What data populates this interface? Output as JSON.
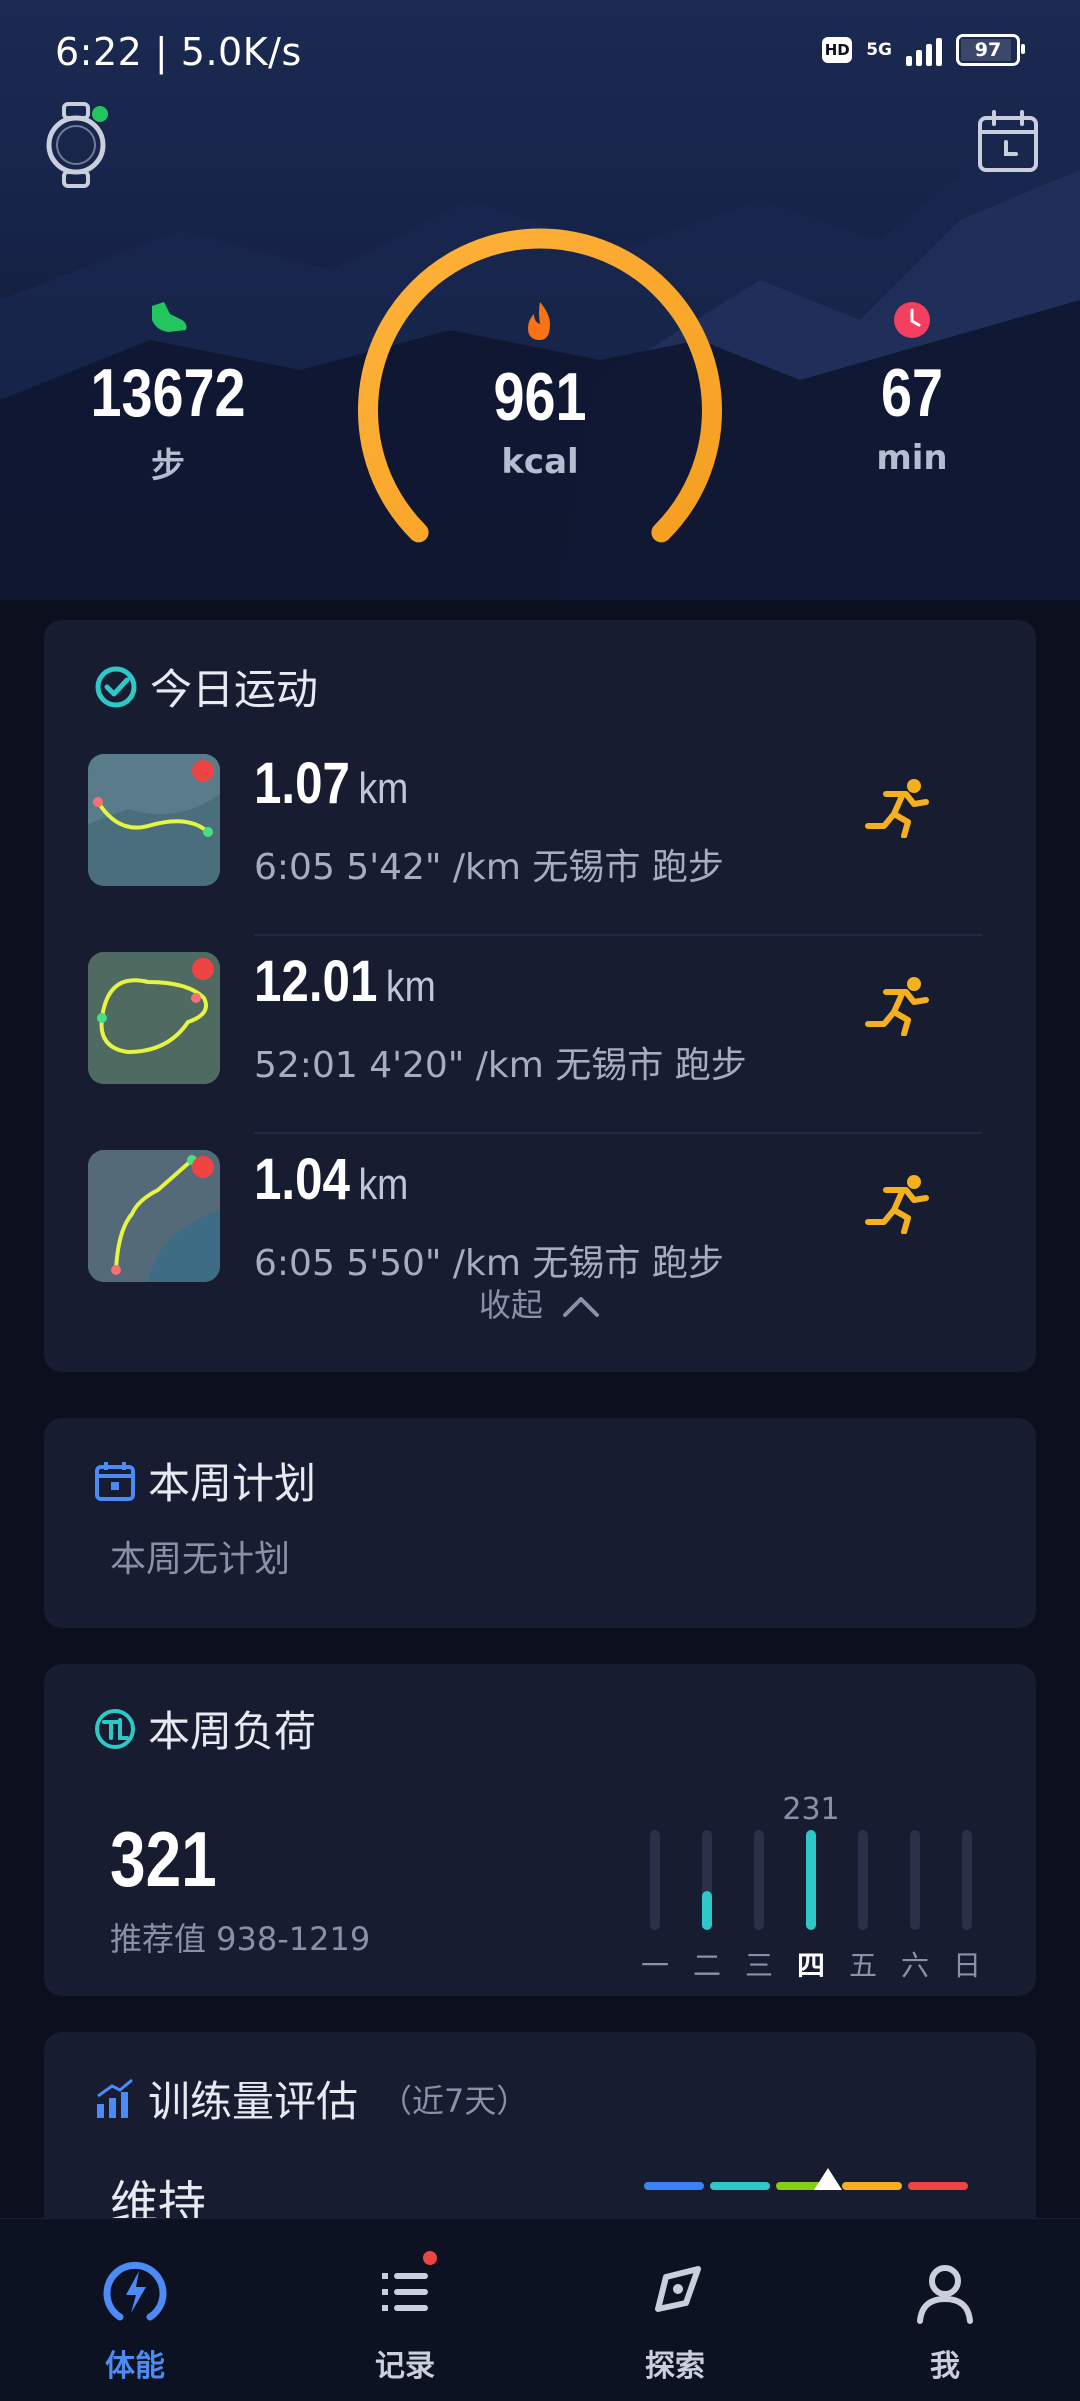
{
  "status_bar": {
    "time": "6:22 | 5.0K/s",
    "hd": "HD",
    "network": "5G",
    "battery": "97",
    "battery_level": 0.97
  },
  "summary": {
    "steps": {
      "icon": "shoe-icon",
      "value": "13672",
      "unit": "步"
    },
    "calories": {
      "icon": "flame-icon",
      "value": "961",
      "unit": "kcal"
    },
    "minutes": {
      "icon": "clock-icon",
      "value": "67",
      "unit": "min"
    }
  },
  "today": {
    "title": "今日运动",
    "icon": "check-circle-icon",
    "runs": [
      {
        "distance": "1.07",
        "unit": "km",
        "details": "6:05  5'42\" /km  无锡市 跑步"
      },
      {
        "distance": "12.01",
        "unit": "km",
        "details": "52:01  4'20\" /km  无锡市 跑步"
      },
      {
        "distance": "1.04",
        "unit": "km",
        "details": "6:05  5'50\" /km  无锡市 跑步"
      }
    ],
    "collapse_label": "收起"
  },
  "plan": {
    "title": "本周计划",
    "icon": "calendar-icon",
    "empty_text": "本周无计划"
  },
  "load": {
    "title": "本周负荷",
    "icon": "tl-icon",
    "value": "321",
    "recommended": "推荐值 938-1219",
    "peak_label": "231",
    "days": [
      "一",
      "二",
      "三",
      "四",
      "五",
      "六",
      "日"
    ],
    "active_day": "四",
    "day_values": [
      0,
      90,
      0,
      231,
      0,
      0,
      0
    ],
    "max": 231
  },
  "training": {
    "title": "训练量评估",
    "period": "（近7天）",
    "icon": "chart-up-icon",
    "status": "维持"
  },
  "colors": {
    "accent": "#4c8bf5",
    "teal": "#2ec8c8",
    "ring_start": "#ffb23a",
    "ring_end": "#f59f20",
    "runner": "#f5b020"
  },
  "tabs": [
    {
      "label": "体能",
      "icon": "bolt-icon",
      "active": true
    },
    {
      "label": "记录",
      "icon": "list-icon",
      "badge": true
    },
    {
      "label": "探索",
      "icon": "compass-icon"
    },
    {
      "label": "我",
      "icon": "person-icon"
    }
  ]
}
